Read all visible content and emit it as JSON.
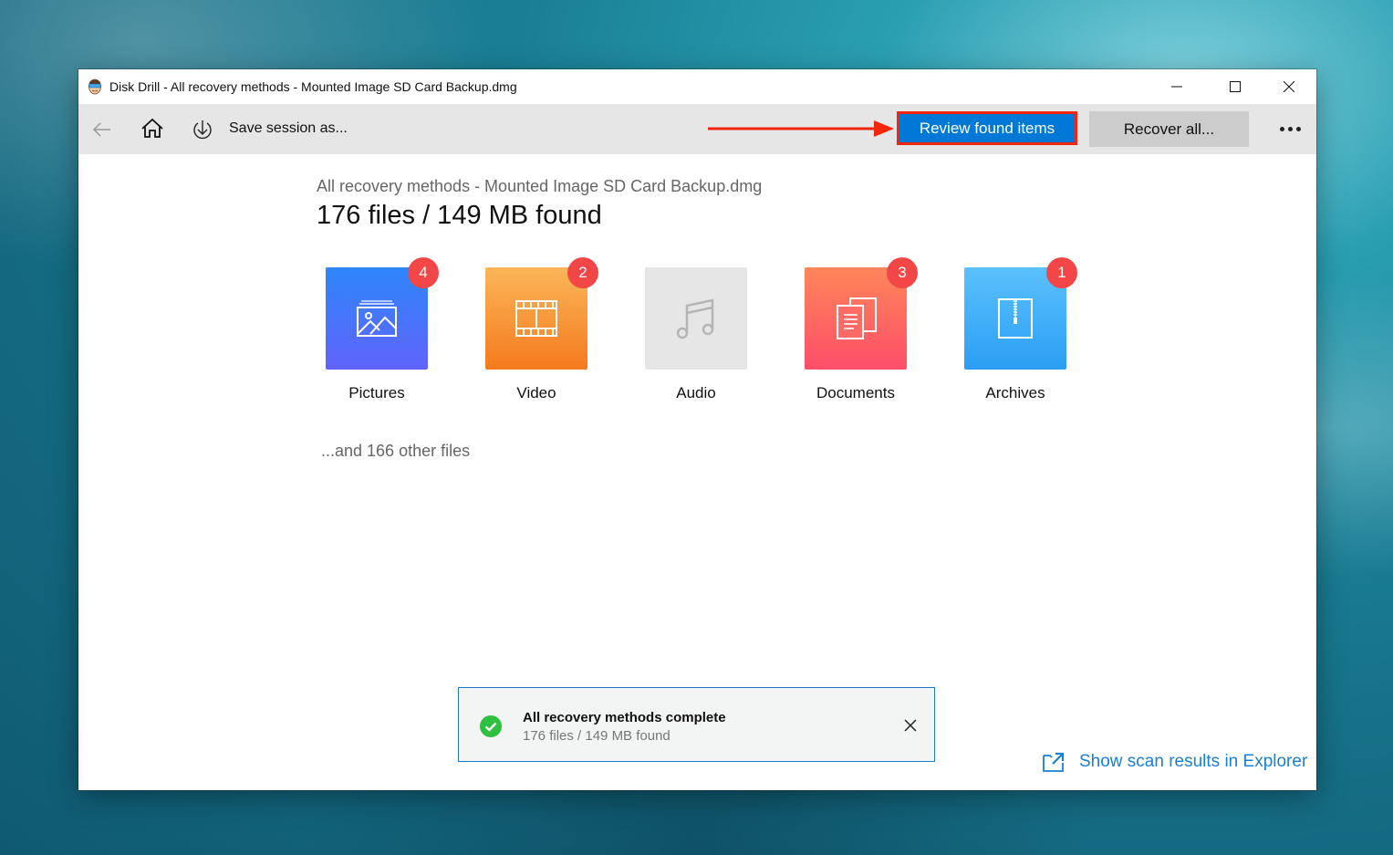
{
  "window": {
    "title": "Disk Drill - All recovery methods - Mounted Image SD Card Backup.dmg",
    "controls": [
      "minimize",
      "maximize",
      "close"
    ]
  },
  "toolbar": {
    "back_icon": "arrow-left-icon",
    "home_icon": "home-icon",
    "save_icon": "download-circle-icon",
    "save_label": "Save session as...",
    "review_label": "Review found items",
    "recover_label": "Recover all...",
    "more_icon": "more-dots-icon"
  },
  "annotation": {
    "arrow_color": "#f2260c",
    "highlight_color": "#f2260c"
  },
  "main": {
    "subtitle": "All recovery methods - Mounted Image SD Card Backup.dmg",
    "headline": "176 files / 149 MB found",
    "categories": [
      {
        "label": "Pictures",
        "count": "4",
        "icon": "picture-icon"
      },
      {
        "label": "Video",
        "count": "2",
        "icon": "film-icon"
      },
      {
        "label": "Audio",
        "count": "",
        "icon": "music-note-icon"
      },
      {
        "label": "Documents",
        "count": "3",
        "icon": "documents-icon"
      },
      {
        "label": "Archives",
        "count": "1",
        "icon": "zip-archive-icon"
      }
    ],
    "other_files": "...and 166 other files"
  },
  "toast": {
    "title": "All recovery methods complete",
    "subtitle": "176 files / 149 MB found",
    "status_color": "#2ec140"
  },
  "footer": {
    "explorer_link": "Show scan results in Explorer"
  },
  "colors": {
    "accent": "#0078d7",
    "badge": "#f34747",
    "link": "#1a7fd6"
  }
}
